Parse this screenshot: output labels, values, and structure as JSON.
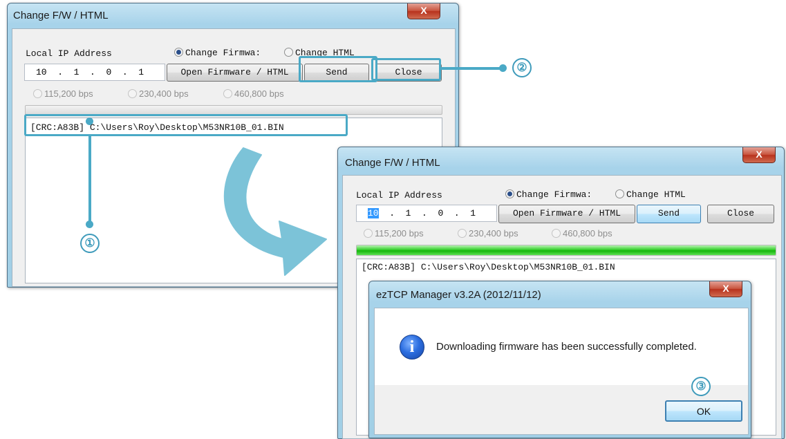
{
  "window_back": {
    "title": "Change F/W / HTML",
    "close_glyph": "X",
    "local_ip_label": "Local IP Address",
    "ip_octets": [
      "10",
      "1",
      "0",
      "1"
    ],
    "radio_firmware": "Change Firmwa:",
    "radio_html": "Change HTML",
    "open_button": "Open Firmware / HTML",
    "send_button": "Send",
    "close_button": "Close",
    "baud_rates": [
      "115,200 bps",
      "230,400 bps",
      "460,800 bps"
    ],
    "log_line": "[CRC:A83B] C:\\Users\\Roy\\Desktop\\M53NR10B_01.BIN",
    "progress_fraction": 0
  },
  "window_front": {
    "title": "Change F/W / HTML",
    "close_glyph": "X",
    "local_ip_label": "Local IP Address",
    "ip_octets": [
      "10",
      "1",
      "0",
      "1"
    ],
    "radio_firmware": "Change Firmwa:",
    "radio_html": "Change HTML",
    "open_button": "Open Firmware / HTML",
    "send_button": "Send",
    "close_button": "Close",
    "baud_rates": [
      "115,200 bps",
      "230,400 bps",
      "460,800 bps"
    ],
    "log_line": "[CRC:A83B] C:\\Users\\Roy\\Desktop\\M53NR10B_01.BIN",
    "progress_fraction": 1
  },
  "dialog": {
    "title": "ezTCP Manager v3.2A (2012/11/12)",
    "close_glyph": "X",
    "icon": "info-icon",
    "message": "Downloading firmware has been successfully completed.",
    "ok_button": "OK"
  },
  "annotations": {
    "step1": "①",
    "step2": "②",
    "step3": "③",
    "color": "#4aa9c6"
  }
}
